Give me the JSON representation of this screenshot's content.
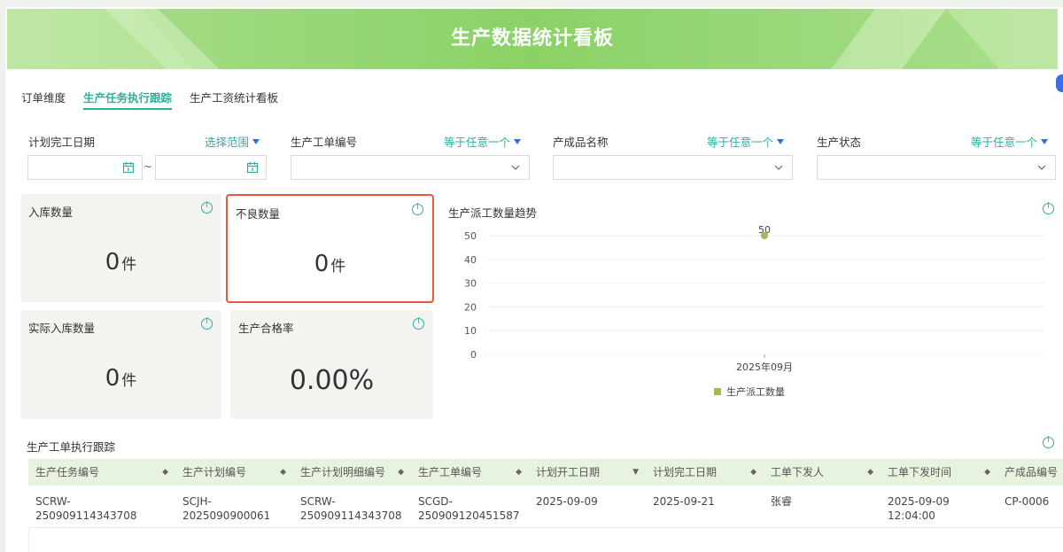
{
  "header": {
    "title": "生产数据统计看板"
  },
  "tabs": [
    {
      "label": "订单维度",
      "active": false
    },
    {
      "label": "生产任务执行跟踪",
      "active": true
    },
    {
      "label": "生产工资统计看板",
      "active": false
    }
  ],
  "filters": {
    "plan_date": {
      "label": "计划完工日期",
      "op": "选择范围",
      "separator": "~"
    },
    "work_order": {
      "label": "生产工单编号",
      "op": "等于任意一个"
    },
    "product_name": {
      "label": "产成品名称",
      "op": "等于任意一个"
    },
    "status": {
      "label": "生产状态",
      "op": "等于任意一个"
    }
  },
  "cards": {
    "inbound": {
      "label": "入库数量",
      "value": "0",
      "unit": "件"
    },
    "defect": {
      "label": "不良数量",
      "value": "0",
      "unit": "件"
    },
    "actual_inbound": {
      "label": "实际入库数量",
      "value": "0",
      "unit": "件"
    },
    "pass_rate": {
      "label": "生产合格率",
      "value": "0.00%"
    }
  },
  "chart_title": "生产派工数量趋势",
  "chart_data": {
    "type": "scatter",
    "categories": [
      "2025年09月"
    ],
    "series": [
      {
        "name": "生产派工数量",
        "values": [
          50
        ],
        "color": "#a7b94e"
      }
    ],
    "data_labels": [
      "50"
    ],
    "ylim": [
      0,
      50
    ],
    "yticks": [
      "0",
      "10",
      "20",
      "30",
      "40",
      "50"
    ],
    "grid": true,
    "legend": "bottom"
  },
  "table": {
    "title": "生产工单执行跟踪",
    "columns": [
      "生产任务编号",
      "生产计划编号",
      "生产计划明细编号",
      "生产工单编号",
      "计划开工日期",
      "计划完工日期",
      "工单下发人",
      "工单下发时间",
      "产成品编号"
    ],
    "sort_icons": [
      "◆",
      "◆",
      "◆",
      "◆",
      "▼",
      "◆",
      "◆",
      "◆",
      ""
    ],
    "rows": [
      [
        "SCRW-250909114343708",
        "SCJH-2025090900061",
        "SCRW-\n250909114343708",
        "SCGD-\n250909120451587",
        "2025-09-09",
        "2025-09-21",
        "张睿",
        "2025-09-09 12:04:00",
        "CP-0006"
      ]
    ]
  },
  "colors": {
    "accent": "#2fae9f",
    "banner": "#8fd46a",
    "selected_border": "#e85a3c"
  }
}
